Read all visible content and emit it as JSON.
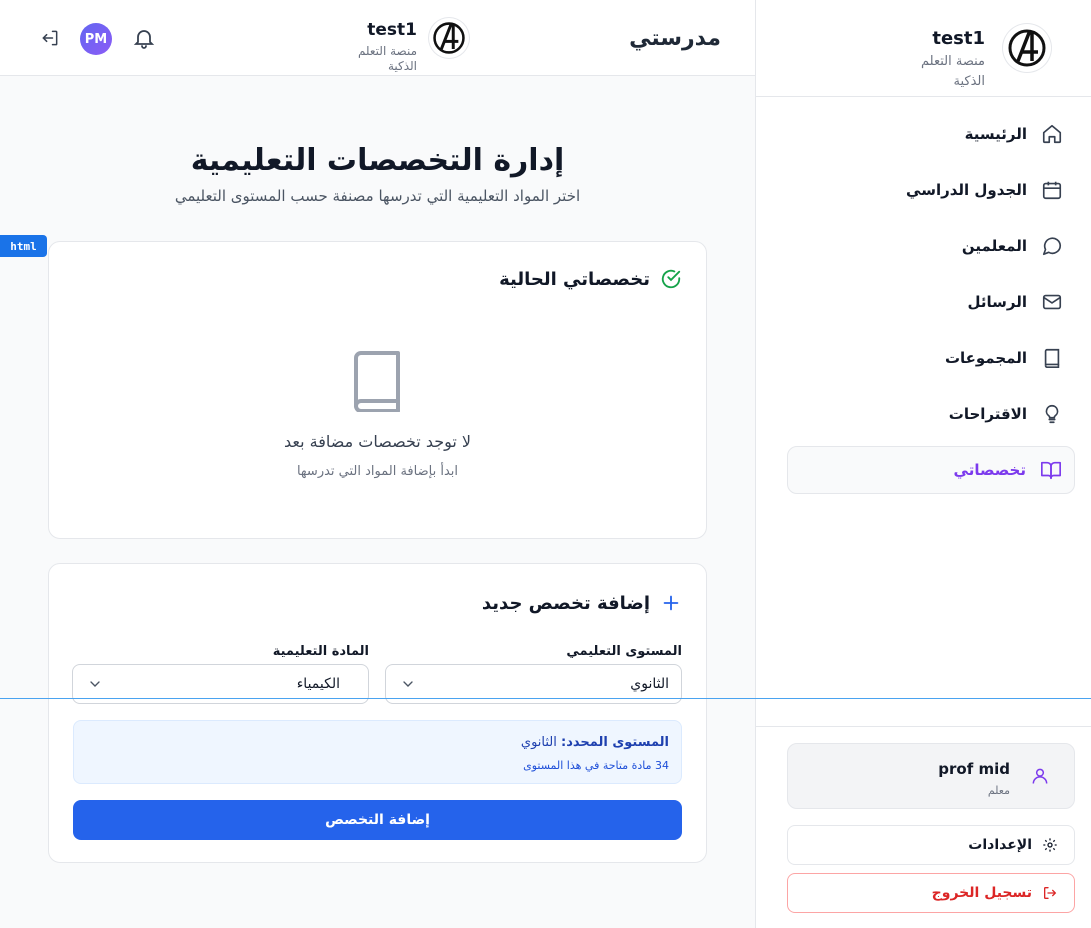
{
  "sidebar": {
    "brand_title": "test1",
    "brand_subtitle": "منصة التعلم الذكية",
    "items": [
      {
        "label": "الرئيسية",
        "icon": "home-icon"
      },
      {
        "label": "الجدول الدراسي",
        "icon": "calendar-icon"
      },
      {
        "label": "المعلمين",
        "icon": "chat-bubble-icon"
      },
      {
        "label": "الرسائل",
        "icon": "mail-icon"
      },
      {
        "label": "المجموعات",
        "icon": "book-icon"
      },
      {
        "label": "الاقتراحات",
        "icon": "lightbulb-icon"
      },
      {
        "label": "تخصصاتي",
        "icon": "open-book-icon",
        "active": true
      }
    ],
    "user": {
      "name": "prof mid",
      "role": "معلم",
      "icon": "user-icon"
    },
    "settings_label": "الإعدادات",
    "logout_label": "تسجيل الخروج"
  },
  "topbar": {
    "app_name": "مدرستي",
    "title": "test1",
    "subtitle": "منصة التعلم الذكية",
    "avatar_initials": "PM",
    "icons": [
      "bell-icon",
      "logout-icon"
    ]
  },
  "main": {
    "title": "إدارة التخصصات التعليمية",
    "subtitle": "اختر المواد التعليمية التي تدرسها مصنفة حسب المستوى التعليمي",
    "current_card": {
      "heading": "تخصصاتي الحالية",
      "empty_title": "لا توجد تخصصات مضافة بعد",
      "empty_sub": "ابدأ بإضافة المواد التي تدرسها"
    },
    "add_card": {
      "heading": "إضافة تخصص جديد",
      "level_label": "المستوى التعليمي",
      "level_value": "الثانوي",
      "subject_label": "المادة التعليمية",
      "subject_value": "الكيمياء",
      "selected_level_label": "المستوى المحدد:",
      "selected_level_value": "الثانوي",
      "available_text": "34 مادة متاحة في هذا المستوى",
      "submit_label": "إضافة التخصص"
    }
  },
  "overlay": {
    "badge": "html"
  },
  "colors": {
    "accent": "#7c3aed",
    "primary": "#2563eb",
    "danger": "#dc2626",
    "success": "#16a34a"
  }
}
